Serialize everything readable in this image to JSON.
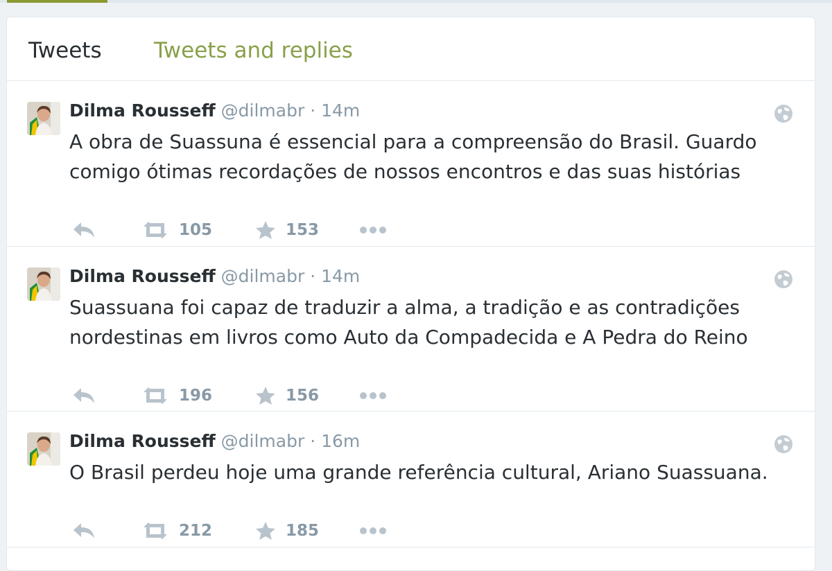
{
  "colors": {
    "accent": "#8c9a32",
    "tab_inactive": "#89a04a",
    "muted": "#8899a6",
    "text": "#292f33",
    "icon": "#b8c3cc"
  },
  "tabs": {
    "tweets": "Tweets",
    "replies": "Tweets and replies"
  },
  "tweets": [
    {
      "name": "Dilma Rousseff",
      "handle": "@dilmabr",
      "sep": "·",
      "time": "14m",
      "text": "A obra de Suassuna é essencial para a compreensão do Brasil. Guardo comigo ótimas recordações de nossos encontros e das suas histórias",
      "retweets": "105",
      "favorites": "153"
    },
    {
      "name": "Dilma Rousseff",
      "handle": "@dilmabr",
      "sep": "·",
      "time": "14m",
      "text": "Suassuana foi capaz de traduzir a alma, a tradição e as contradições nordestinas em livros como Auto da Compadecida e A Pedra do Reino",
      "retweets": "196",
      "favorites": "156"
    },
    {
      "name": "Dilma Rousseff",
      "handle": "@dilmabr",
      "sep": "·",
      "time": "16m",
      "text": "O Brasil perdeu hoje uma grande referência cultural, Ariano Suassuana.",
      "retweets": "212",
      "favorites": "185"
    }
  ],
  "icons": {
    "reply": "reply-icon",
    "retweet": "retweet-icon",
    "favorite": "star-icon",
    "more": "more-icon",
    "globe": "globe-icon"
  }
}
